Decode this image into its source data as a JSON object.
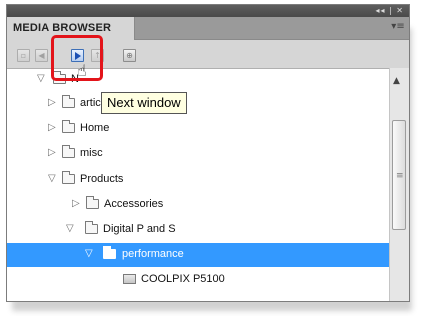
{
  "panel": {
    "collapse_controls": "◂◂ | ✕",
    "tab_label": "MEDIA BROWSER",
    "panel_menu_glyph": "▾≡"
  },
  "toolbar": {
    "buttons": [
      {
        "name": "home-button",
        "glyph": "▫",
        "enabled": false
      },
      {
        "name": "previous-window-button",
        "glyph": "◀",
        "enabled": false
      },
      {
        "name": "next-window-button",
        "glyph": "▶",
        "enabled": true
      },
      {
        "name": "up-button",
        "glyph": "↑",
        "enabled": false
      },
      {
        "name": "add-location-button",
        "glyph": "⊕",
        "enabled": false
      }
    ],
    "highlight_color": "#e3141a"
  },
  "tooltip": {
    "text": "Next window"
  },
  "tree": {
    "selected_color": "#3399ff",
    "rows": [
      {
        "label": "N",
        "expanded": true,
        "type": "folder",
        "level": 0
      },
      {
        "label": "article images",
        "expanded": false,
        "type": "folder",
        "level": 1
      },
      {
        "label": "Home",
        "expanded": false,
        "type": "folder",
        "level": 1
      },
      {
        "label": "misc",
        "expanded": false,
        "type": "folder",
        "level": 1
      },
      {
        "label": "Products",
        "expanded": true,
        "type": "folder",
        "level": 1
      },
      {
        "label": "Accessories",
        "expanded": false,
        "type": "folder",
        "level": 2
      },
      {
        "label": "Digital P and S",
        "expanded": true,
        "type": "folder",
        "level": 2
      },
      {
        "label": "performance",
        "expanded": true,
        "type": "folder",
        "level": 3,
        "selected": true
      },
      {
        "label": "COOLPIX P5100",
        "type": "file",
        "level": 4
      }
    ]
  }
}
